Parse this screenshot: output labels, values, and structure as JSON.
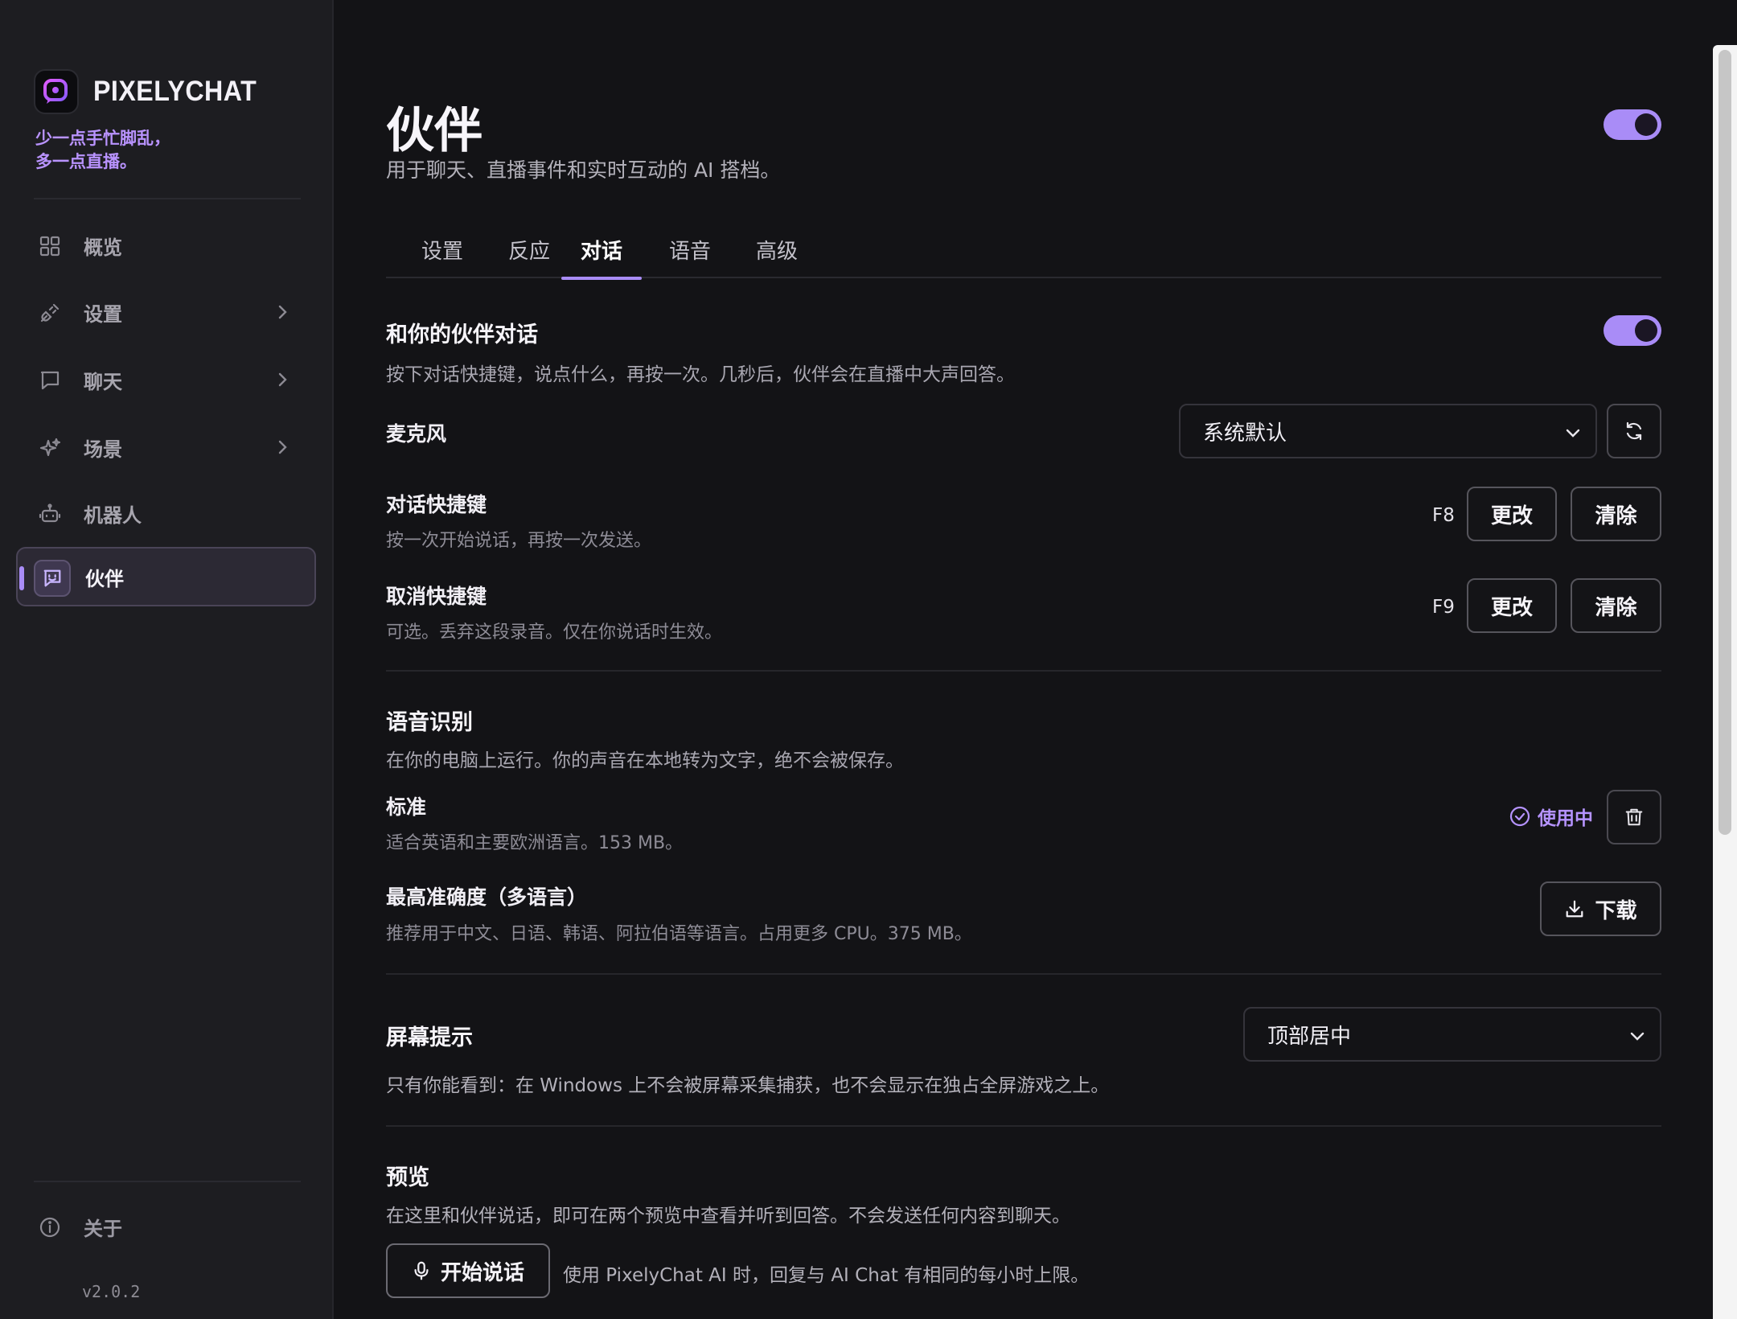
{
  "app": {
    "name": "PIXELYCHAT",
    "tagline_line1": "少一点手忙脚乱，",
    "tagline_line2": "多一点直播。",
    "version": "v2.0.2",
    "accent_color": "#a98cf7"
  },
  "sidebar": {
    "items": [
      {
        "label": "概览",
        "icon": "grid-icon",
        "has_chevron": false
      },
      {
        "label": "设置",
        "icon": "plug-icon",
        "has_chevron": true
      },
      {
        "label": "聊天",
        "icon": "chat-bubble-icon",
        "has_chevron": true
      },
      {
        "label": "场景",
        "icon": "sparkle-icon",
        "has_chevron": true
      },
      {
        "label": "机器人",
        "icon": "robot-icon",
        "has_chevron": false
      },
      {
        "label": "伙伴",
        "icon": "companion-icon",
        "has_chevron": false,
        "active": true
      }
    ],
    "about_label": "关于"
  },
  "page": {
    "title": "伙伴",
    "subtitle": "用于聊天、直播事件和实时互动的 AI 搭档。",
    "enabled": true,
    "tabs": [
      "设置",
      "反应",
      "对话",
      "语音",
      "高级"
    ],
    "active_tab": "对话"
  },
  "talk": {
    "title": "和你的伙伴对话",
    "description": "按下对话快捷键，说点什么，再按一次。几秒后，伙伴会在直播中大声回答。",
    "enabled": true,
    "microphone_label": "麦克风",
    "microphone_value": "系统默认",
    "hotkey_title": "对话快捷键",
    "hotkey_desc": "按一次开始说话，再按一次发送。",
    "hotkey_value": "F8",
    "cancel_title": "取消快捷键",
    "cancel_desc": "可选。丢弃这段录音。仅在你说话时生效。",
    "cancel_value": "F9",
    "change_label": "更改",
    "clear_label": "清除"
  },
  "speech": {
    "title": "语音识别",
    "description": "在你的电脑上运行。你的声音在本地转为文字，绝不会被保存。",
    "standard_title": "标准",
    "standard_desc": "适合英语和主要欧洲语言。153 MB。",
    "in_use_label": "使用中",
    "best_title": "最高准确度（多语言）",
    "best_desc": "推荐用于中文、日语、韩语、阿拉伯语等语言。占用更多 CPU。375 MB。",
    "download_label": "下载"
  },
  "overlay": {
    "title": "屏幕提示",
    "value": "顶部居中",
    "description": "只有你能看到：在 Windows 上不会被屏幕采集捕获，也不会显示在独占全屏游戏之上。"
  },
  "preview": {
    "title": "预览",
    "description": "在这里和伙伴说话，即可在两个预览中查看并听到回答。不会发送任何内容到聊天。",
    "start_label": "开始说话",
    "note": "使用 PixelyChat AI 时，回复与 AI Chat 有相同的每小时上限。"
  }
}
